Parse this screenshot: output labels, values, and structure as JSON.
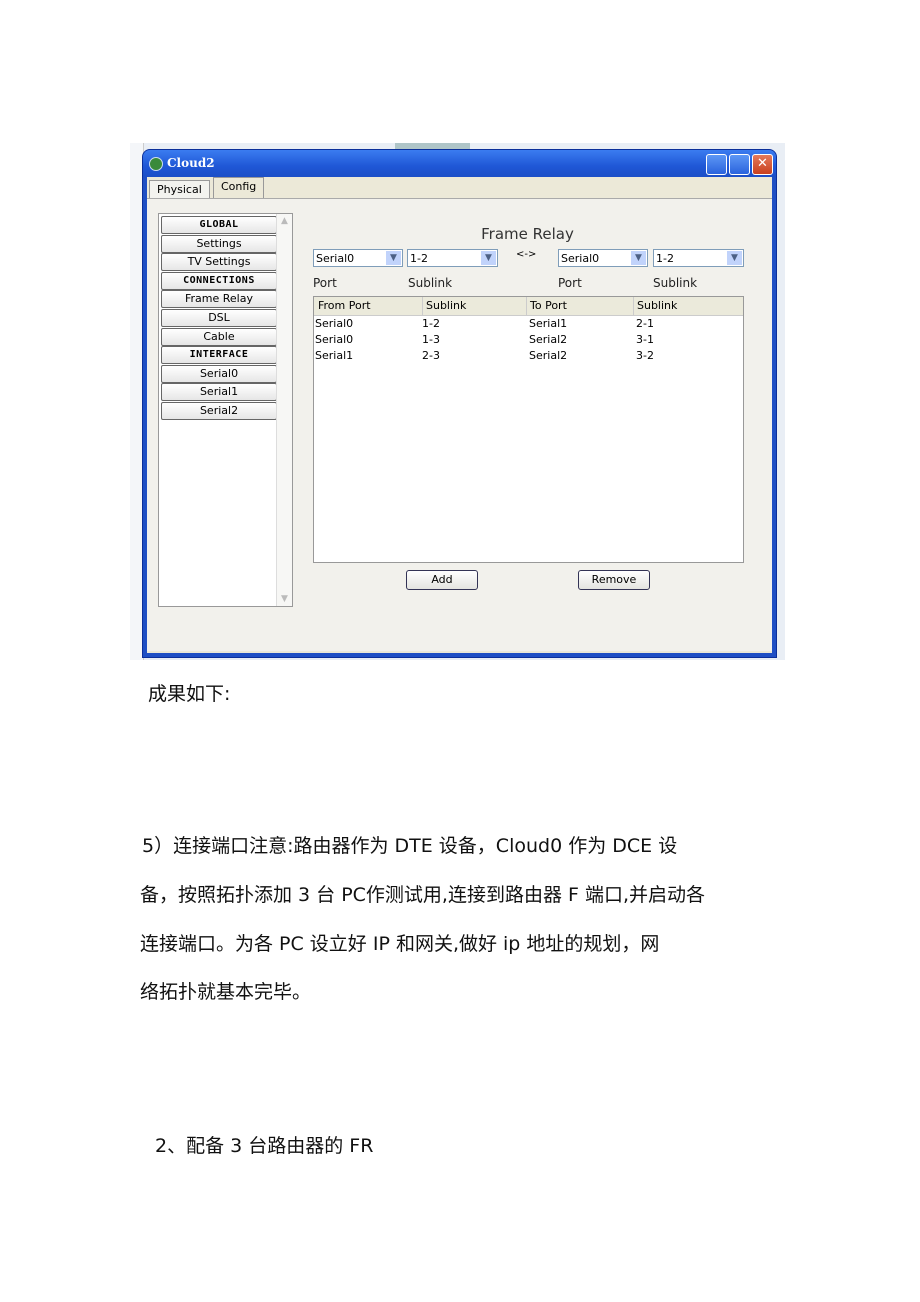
{
  "window": {
    "title": "Cloud2",
    "tabs": [
      "Physical",
      "Config"
    ],
    "active_tab": "Config"
  },
  "sidebar": {
    "items": [
      {
        "label": "GLOBAL",
        "header": true
      },
      {
        "label": "Settings"
      },
      {
        "label": "TV Settings"
      },
      {
        "label": "CONNECTIONS",
        "header": true
      },
      {
        "label": "Frame Relay"
      },
      {
        "label": "DSL"
      },
      {
        "label": "Cable"
      },
      {
        "label": "INTERFACE",
        "header": true
      },
      {
        "label": "Serial0"
      },
      {
        "label": "Serial1"
      },
      {
        "label": "Serial2"
      }
    ]
  },
  "frame_relay": {
    "title": "Frame Relay",
    "from_port": "Serial0",
    "from_sublink": "1-2",
    "separator": "<->",
    "to_port": "Serial0",
    "to_sublink": "1-2",
    "labels": {
      "port1": "Port",
      "sublink1": "Sublink",
      "port2": "Port",
      "sublink2": "Sublink"
    },
    "columns": [
      "From Port",
      "Sublink",
      "To Port",
      "Sublink"
    ],
    "rows": [
      [
        "Serial0",
        "1-2",
        "Serial1",
        "2-1"
      ],
      [
        "Serial0",
        "1-3",
        "Serial2",
        "3-1"
      ],
      [
        "Serial1",
        "2-3",
        "Serial2",
        "3-2"
      ]
    ],
    "add_label": "Add",
    "remove_label": "Remove"
  },
  "document": {
    "caption": "成果如下:",
    "para_lines": [
      "5）连接端口注意:路由器作为 DTE 设备，Cloud0 作为 DCE 设",
      "备，按照拓扑添加 3 台 PC作测试用,连接到路由器 F 端口,并启动各",
      "连接端口。为各 PC 设立好 IP 和网关,做好 ip 地址的规划，网",
      "络拓扑就基本完毕。"
    ],
    "heading": "2、配备 3 台路由器的 FR"
  }
}
